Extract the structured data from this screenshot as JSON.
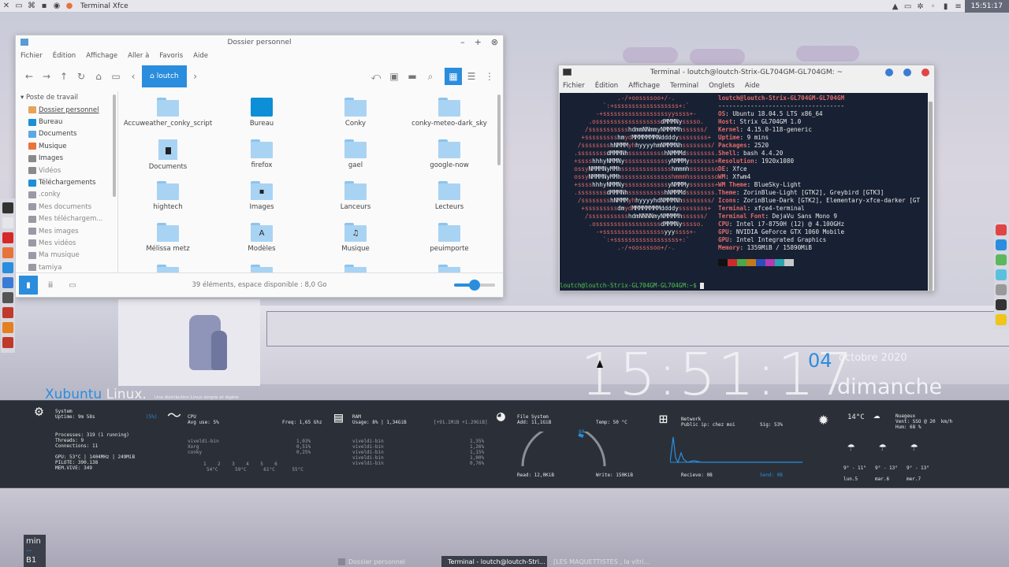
{
  "top_panel": {
    "active_window": "Terminal Xfce",
    "clock": "15:51:17"
  },
  "file_manager": {
    "title": "Dossier personnel",
    "menu": [
      "Fichier",
      "Édition",
      "Affichage",
      "Aller à",
      "Favoris",
      "Aide"
    ],
    "location": "loutch",
    "sidebar_header": "Poste de travail",
    "sidebar_items": [
      {
        "label": "Dossier personnel",
        "icon": "home-icon",
        "color": "#e8a35a"
      },
      {
        "label": "Bureau",
        "icon": "desktop-icon",
        "color": "#1b8fd8"
      },
      {
        "label": "Documents",
        "icon": "folder-icon",
        "color": "#5aa9e6"
      },
      {
        "label": "Musique",
        "icon": "music-icon",
        "color": "#e8743b"
      },
      {
        "label": "Images",
        "icon": "image-icon",
        "color": "#8a8a8a"
      },
      {
        "label": "Vidéos",
        "icon": "video-icon",
        "color": "#8a8a8a",
        "muted": true
      },
      {
        "label": "Téléchargements",
        "icon": "download-icon",
        "color": "#1b8fd8"
      },
      {
        "label": ".conky",
        "icon": "folder-icon",
        "color": "#9a9aa6",
        "muted": true
      },
      {
        "label": "Mes documents",
        "icon": "folder-icon",
        "color": "#9a9aa6",
        "muted": true
      },
      {
        "label": "Mes téléchargem...",
        "icon": "folder-icon",
        "color": "#9a9aa6",
        "muted": true
      },
      {
        "label": "Mes images",
        "icon": "folder-icon",
        "color": "#9a9aa6",
        "muted": true
      },
      {
        "label": "Mes vidéos",
        "icon": "folder-icon",
        "color": "#9a9aa6",
        "muted": true
      },
      {
        "label": "Ma musique",
        "icon": "folder-icon",
        "color": "#9a9aa6",
        "muted": true
      },
      {
        "label": "tamiya",
        "icon": "folder-icon",
        "color": "#9a9aa6",
        "muted": true
      }
    ],
    "files": [
      {
        "name": "Accuweather_conky_script",
        "kind": "folder"
      },
      {
        "name": "Bureau",
        "kind": "desktop"
      },
      {
        "name": "Conky",
        "kind": "folder"
      },
      {
        "name": "conky-meteo-dark_sky",
        "kind": "folder"
      },
      {
        "name": "Documents",
        "kind": "doc"
      },
      {
        "name": "firefox",
        "kind": "folder"
      },
      {
        "name": "gael",
        "kind": "folder"
      },
      {
        "name": "google-now",
        "kind": "folder"
      },
      {
        "name": "hightech",
        "kind": "folder"
      },
      {
        "name": "Images",
        "kind": "folder",
        "glyph": "▪"
      },
      {
        "name": "Lanceurs",
        "kind": "folder"
      },
      {
        "name": "Lecteurs",
        "kind": "folder"
      },
      {
        "name": "Mélissa metz",
        "kind": "folder"
      },
      {
        "name": "Modèles",
        "kind": "folder",
        "glyph": "A"
      },
      {
        "name": "Musique",
        "kind": "folder",
        "glyph": "♫"
      },
      {
        "name": "peuimporte",
        "kind": "folder"
      }
    ],
    "status": "39 éléments, espace disponible : 8,0 Go"
  },
  "terminal": {
    "title": "Terminal - loutch@loutch-Strix-GL704GM-GL704GM: ~",
    "menu": [
      "Fichier",
      "Édition",
      "Affichage",
      "Terminal",
      "Onglets",
      "Aide"
    ],
    "header": "loutch@loutch-Strix-GL704GM-GL704GM",
    "separator": "-----------------------------------",
    "info": [
      {
        "key": "OS",
        "value": "Ubuntu 18.04.5 LTS x86_64"
      },
      {
        "key": "Host",
        "value": "Strix GL704GM 1.0"
      },
      {
        "key": "Kernel",
        "value": "4.15.0-118-generic"
      },
      {
        "key": "Uptime",
        "value": "9 mins"
      },
      {
        "key": "Packages",
        "value": "2520"
      },
      {
        "key": "Shell",
        "value": "bash 4.4.20"
      },
      {
        "key": "Resolution",
        "value": "1920x1080"
      },
      {
        "key": "DE",
        "value": "Xfce"
      },
      {
        "key": "WM",
        "value": "Xfwm4"
      },
      {
        "key": "WM Theme",
        "value": "BlueSky-Light"
      },
      {
        "key": "Theme",
        "value": "ZorinBlue-Light [GTK2], Greybird [GTK3]"
      },
      {
        "key": "Icons",
        "value": "ZorinBlue-Dark [GTK2], Elementary-xfce-darker [GT"
      },
      {
        "key": "Terminal",
        "value": "xfce4-terminal"
      },
      {
        "key": "Terminal Font",
        "value": "DejaVu Sans Mono 9"
      },
      {
        "key": "CPU",
        "value": "Intel i7-8750H (12) @ 4.100GHz"
      },
      {
        "key": "GPU",
        "value": "NVIDIA GeForce GTX 1060 Mobile"
      },
      {
        "key": "GPU",
        "value": "Intel Integrated Graphics"
      },
      {
        "key": "Memory",
        "value": "1359MiB / 15890MiB"
      }
    ],
    "swatches": [
      "#111111",
      "#cc2b2b",
      "#4aa84a",
      "#c47a1a",
      "#2a4fb8",
      "#b53ab5",
      "#2aa6b0",
      "#c8c8c8"
    ],
    "prompt": "loutch@loutch-Strix-GL704GM-GL704GM:~$ "
  },
  "desktop": {
    "time": "15:51:17",
    "day": "04",
    "month": "octobre 2020",
    "weekday": "dimanche",
    "brand": "Xubuntu",
    "brand_suffix": " Linux.",
    "brand_sub": "Une distribution Linux simple et légère"
  },
  "conky": {
    "system": {
      "title": "System",
      "uptime": "Uptime: 9m 58s",
      "percent": "(5%)",
      "processes": "Processes: 319 (1 running)",
      "threads": "Threads: 9",
      "connections": "Connections: 11",
      "gpu": "GPU: 53°C | 1404MHz | 249MiB",
      "pilote": "PILOTE: 390.138",
      "mem": "MEM.VIVE: 349"
    },
    "cpu": {
      "title": "CPU",
      "usage": "Avg use: 5%",
      "freq": "Freq: 1,65 Ghz",
      "procs": [
        {
          "name": "viveldi-bin",
          "val": "1,03%"
        },
        {
          "name": "Xorg",
          "val": "0,51%"
        },
        {
          "name": "conky",
          "val": "0,25%"
        }
      ],
      "cores": "1    2    3    4    5    6",
      "temps": "54°C      59°C      61°C      55°C"
    },
    "ram": {
      "title": "RAM",
      "usage": "Usage: 8% | 1,34GiB",
      "total": "[+91.1MiB +1.29GiB]",
      "procs": [
        {
          "name": "viveldi-bin",
          "val": "1,35%"
        },
        {
          "name": "viveldi-bin",
          "val": "1,26%"
        },
        {
          "name": "viveldi-bin",
          "val": "1,15%"
        },
        {
          "name": "viveldi-bin",
          "val": "1,00%"
        },
        {
          "name": "viveldi-bin",
          "val": "0,76%"
        }
      ]
    },
    "fs": {
      "title": "File System",
      "add": "Add: 11,1GiB",
      "temp": "Temp: 50 °C",
      "read": "Read: 12,0KiB",
      "write": "Write: 150KiB",
      "gauge_value": "80"
    },
    "net": {
      "title": "Network",
      "ip": "Public ip: chez moi",
      "sig": "Sig: 53%",
      "recv": "Recieve: 0B",
      "send": "Send: 0B"
    },
    "weather": {
      "temp": "14°C",
      "cond": "Nuageux",
      "wind": "Vent: SSO @ 20  km/h",
      "hum": "Hum: 68 %",
      "days": [
        {
          "temps": "9° - 11°",
          "label": "lun.5"
        },
        {
          "temps": "9° - 13°",
          "label": "mar.6"
        },
        {
          "temps": "9° - 13°",
          "label": "mer.7"
        }
      ]
    }
  },
  "taskbar": {
    "workspace": [
      "min",
      "--",
      "B1"
    ],
    "tasks": [
      {
        "label": "Dossier personnel"
      },
      {
        "label": "Terminal - loutch@loutch-Stri..."
      },
      {
        "label": "[LES MAQUETTISTES , la vitri..."
      }
    ]
  }
}
